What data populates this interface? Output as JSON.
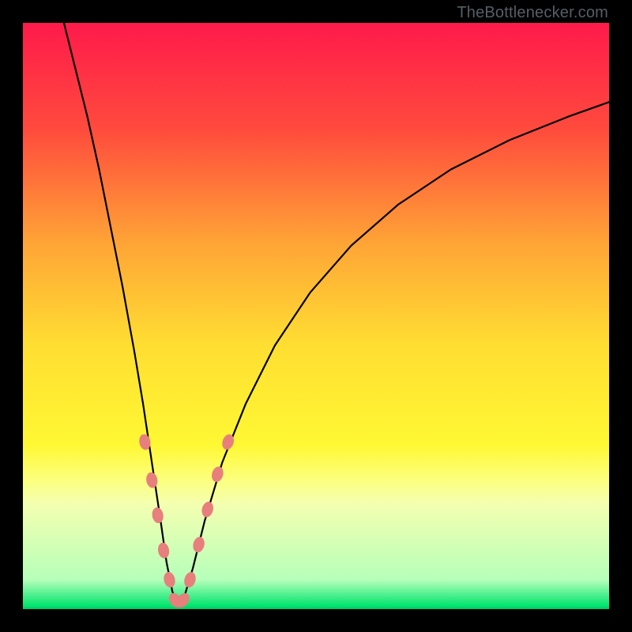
{
  "watermark": "TheBottlenecker.com",
  "chart_data": {
    "type": "line",
    "title": "",
    "xlabel": "",
    "ylabel": "",
    "xlim": [
      0,
      100
    ],
    "ylim": [
      0,
      100
    ],
    "gradient_stops": [
      {
        "pct": 0,
        "color": "#ff1a4b"
      },
      {
        "pct": 18,
        "color": "#ff4a3d"
      },
      {
        "pct": 38,
        "color": "#ffa636"
      },
      {
        "pct": 55,
        "color": "#ffde32"
      },
      {
        "pct": 72,
        "color": "#fff833"
      },
      {
        "pct": 78,
        "color": "#fcff7d"
      },
      {
        "pct": 82,
        "color": "#f4ffb0"
      },
      {
        "pct": 95,
        "color": "#b6ffba"
      },
      {
        "pct": 99.5,
        "color": "#00e56e"
      },
      {
        "pct": 100,
        "color": "#00c763"
      }
    ],
    "series": [
      {
        "name": "left-branch",
        "color": "#000000",
        "stroke_width": 2.2,
        "values": [
          {
            "x": 7.0,
            "y": 100.0
          },
          {
            "x": 9.0,
            "y": 92.0
          },
          {
            "x": 11.0,
            "y": 84.0
          },
          {
            "x": 13.0,
            "y": 75.0
          },
          {
            "x": 15.0,
            "y": 65.0
          },
          {
            "x": 17.0,
            "y": 55.0
          },
          {
            "x": 19.0,
            "y": 44.0
          },
          {
            "x": 20.5,
            "y": 35.0
          },
          {
            "x": 22.0,
            "y": 25.0
          },
          {
            "x": 23.5,
            "y": 15.0
          },
          {
            "x": 24.5,
            "y": 8.0
          },
          {
            "x": 25.5,
            "y": 3.0
          },
          {
            "x": 26.5,
            "y": 0.5
          }
        ]
      },
      {
        "name": "right-branch",
        "color": "#000000",
        "stroke_width": 2.2,
        "values": [
          {
            "x": 26.5,
            "y": 0.5
          },
          {
            "x": 27.5,
            "y": 2.0
          },
          {
            "x": 29.0,
            "y": 7.0
          },
          {
            "x": 31.0,
            "y": 15.0
          },
          {
            "x": 34.0,
            "y": 25.0
          },
          {
            "x": 38.0,
            "y": 35.0
          },
          {
            "x": 43.0,
            "y": 45.0
          },
          {
            "x": 49.0,
            "y": 54.0
          },
          {
            "x": 56.0,
            "y": 62.0
          },
          {
            "x": 64.0,
            "y": 69.0
          },
          {
            "x": 73.0,
            "y": 75.0
          },
          {
            "x": 83.0,
            "y": 80.0
          },
          {
            "x": 93.0,
            "y": 84.0
          },
          {
            "x": 100.0,
            "y": 86.5
          }
        ]
      }
    ],
    "markers": {
      "name": "highlight-beads",
      "color": "#e77f7c",
      "rx": 7,
      "ry": 10,
      "points": [
        {
          "x": 20.8,
          "y": 28.5
        },
        {
          "x": 22.0,
          "y": 22.0
        },
        {
          "x": 23.0,
          "y": 16.0
        },
        {
          "x": 24.0,
          "y": 10.0
        },
        {
          "x": 25.0,
          "y": 5.0
        },
        {
          "x": 26.0,
          "y": 1.5
        },
        {
          "x": 27.3,
          "y": 1.5
        },
        {
          "x": 28.5,
          "y": 5.0
        },
        {
          "x": 30.0,
          "y": 11.0
        },
        {
          "x": 31.5,
          "y": 17.0
        },
        {
          "x": 33.2,
          "y": 23.0
        },
        {
          "x": 35.0,
          "y": 28.5
        }
      ]
    }
  }
}
